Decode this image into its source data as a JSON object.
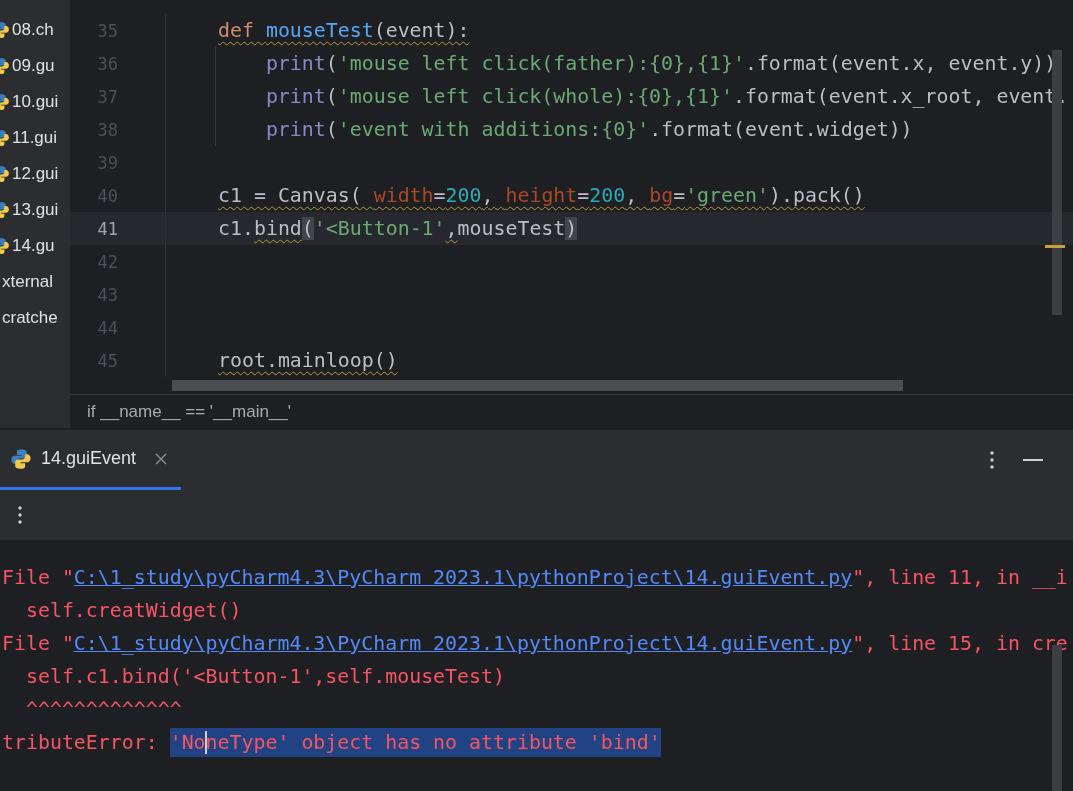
{
  "project_tree": {
    "items": [
      {
        "label": "08.ch",
        "kind": "file"
      },
      {
        "label": "09.gu",
        "kind": "file"
      },
      {
        "label": "10.gui",
        "kind": "file"
      },
      {
        "label": "11.gui",
        "kind": "file"
      },
      {
        "label": "12.gui",
        "kind": "file"
      },
      {
        "label": "13.gui",
        "kind": "file"
      },
      {
        "label": "14.gu",
        "kind": "file"
      },
      {
        "label": "xternal",
        "kind": "group"
      },
      {
        "label": "cratche",
        "kind": "group"
      }
    ]
  },
  "editor": {
    "lines": [
      {
        "number": "35",
        "current": false,
        "nested": false,
        "tokens": [
          {
            "text": "def ",
            "kind": "keyword",
            "squiggle": true,
            "match": false
          },
          {
            "text": "mouseTest",
            "kind": "function",
            "squiggle": true,
            "match": false
          },
          {
            "text": "(event):",
            "kind": "plain",
            "squiggle": true,
            "match": false
          }
        ]
      },
      {
        "number": "36",
        "current": false,
        "nested": true,
        "tokens": [
          {
            "text": "print",
            "kind": "builtin",
            "squiggle": false,
            "match": false
          },
          {
            "text": "(",
            "kind": "plain",
            "squiggle": false,
            "match": false
          },
          {
            "text": "'mouse left click(father):{0},{1}'",
            "kind": "string",
            "squiggle": false,
            "match": false
          },
          {
            "text": ".format(event.x, event.y))",
            "kind": "plain",
            "squiggle": false,
            "match": false
          }
        ]
      },
      {
        "number": "37",
        "current": false,
        "nested": true,
        "tokens": [
          {
            "text": "print",
            "kind": "builtin",
            "squiggle": false,
            "match": false
          },
          {
            "text": "(",
            "kind": "plain",
            "squiggle": false,
            "match": false
          },
          {
            "text": "'mouse left click(whole):{0},{1}'",
            "kind": "string",
            "squiggle": false,
            "match": false
          },
          {
            "text": ".format(event.x_root, event.",
            "kind": "plain",
            "squiggle": false,
            "match": false
          }
        ]
      },
      {
        "number": "38",
        "current": false,
        "nested": true,
        "tokens": [
          {
            "text": "print",
            "kind": "builtin",
            "squiggle": false,
            "match": false
          },
          {
            "text": "(",
            "kind": "plain",
            "squiggle": false,
            "match": false
          },
          {
            "text": "'event with additions:{0}'",
            "kind": "string",
            "squiggle": false,
            "match": false
          },
          {
            "text": ".format(event.widget))",
            "kind": "plain",
            "squiggle": false,
            "match": false
          }
        ]
      },
      {
        "number": "39",
        "current": false,
        "nested": false
      },
      {
        "number": "40",
        "current": false,
        "nested": false,
        "tokens": [
          {
            "text": "c1 = Canvas( ",
            "kind": "plain",
            "squiggle": true,
            "match": false
          },
          {
            "text": "width",
            "kind": "param",
            "squiggle": true,
            "match": false
          },
          {
            "text": "=",
            "kind": "plain",
            "squiggle": true,
            "match": false
          },
          {
            "text": "200",
            "kind": "number",
            "squiggle": true,
            "match": false
          },
          {
            "text": ", ",
            "kind": "plain",
            "squiggle": true,
            "match": false
          },
          {
            "text": "height",
            "kind": "param",
            "squiggle": true,
            "match": false
          },
          {
            "text": "=",
            "kind": "plain",
            "squiggle": true,
            "match": false
          },
          {
            "text": "200",
            "kind": "number",
            "squiggle": true,
            "match": false
          },
          {
            "text": ", ",
            "kind": "plain",
            "squiggle": true,
            "match": false
          },
          {
            "text": "bg",
            "kind": "param",
            "squiggle": true,
            "match": false
          },
          {
            "text": "=",
            "kind": "plain",
            "squiggle": true,
            "match": false
          },
          {
            "text": "'green'",
            "kind": "string",
            "squiggle": true,
            "match": false
          },
          {
            "text": ").pack()",
            "kind": "plain",
            "squiggle": true,
            "match": false
          }
        ]
      },
      {
        "number": "41",
        "current": true,
        "nested": false,
        "tokens": [
          {
            "text": "c1.",
            "kind": "plain",
            "squiggle": false,
            "match": false
          },
          {
            "text": "bind",
            "kind": "plain",
            "squiggle": true,
            "match": false
          },
          {
            "text": "(",
            "kind": "plain",
            "squiggle": false,
            "match": true
          },
          {
            "text": "'<Button-1'",
            "kind": "string",
            "squiggle": false,
            "match": false
          },
          {
            "text": ",",
            "kind": "plain",
            "squiggle": true,
            "match": false
          },
          {
            "text": "mouseTest",
            "kind": "plain",
            "squiggle": false,
            "match": false
          },
          {
            "text": ")",
            "kind": "plain",
            "squiggle": false,
            "match": true
          }
        ]
      },
      {
        "number": "42",
        "current": false,
        "nested": false
      },
      {
        "number": "43",
        "current": false,
        "nested": false
      },
      {
        "number": "44",
        "current": false,
        "nested": false
      },
      {
        "number": "45",
        "current": false,
        "nested": false,
        "tokens": [
          {
            "text": "root.mainloop()",
            "kind": "plain",
            "squiggle": true,
            "match": false
          }
        ]
      }
    ],
    "breadcrumb": "if __name__ == '__main__'"
  },
  "run_window": {
    "tabs": [
      {
        "label": "14.guiEvent",
        "selected": true
      }
    ],
    "console": [
      {
        "segments": [
          {
            "text": "File \"",
            "kind": "error"
          },
          {
            "text": "C:\\1_study\\pyCharm4.3\\PyCharm 2023.1\\pythonProject\\14.guiEvent.py",
            "kind": "link"
          },
          {
            "text": "\", line 11, in __i",
            "kind": "error"
          }
        ]
      },
      {
        "segments": [
          {
            "text": "  self.creatWidget()",
            "kind": "error"
          }
        ]
      },
      {
        "segments": [
          {
            "text": "File \"",
            "kind": "error"
          },
          {
            "text": "C:\\1_study\\pyCharm4.3\\PyCharm 2023.1\\pythonProject\\14.guiEvent.py",
            "kind": "link"
          },
          {
            "text": "\", line 15, in cre",
            "kind": "error"
          }
        ]
      },
      {
        "segments": [
          {
            "text": "  self.c1.bind('<Button-1',self.mouseTest)",
            "kind": "error"
          }
        ]
      },
      {
        "segments": [
          {
            "text": "  ^^^^^^^^^^^^^",
            "kind": "error"
          }
        ]
      },
      {
        "segments": [
          {
            "text": "tributeError: ",
            "kind": "error"
          },
          {
            "text": "'NoneType' object has no attribute 'bind'",
            "kind": "selected"
          }
        ]
      }
    ]
  }
}
